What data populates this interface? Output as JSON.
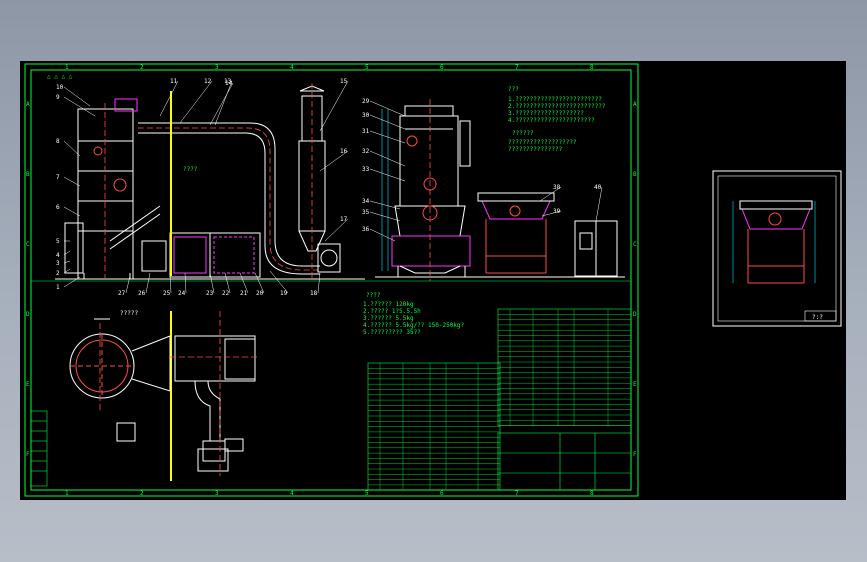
{
  "colors": {
    "viewport_bg": "#000000",
    "frame": "#00ff3c",
    "equipment": "#ffffff",
    "ducting": "#ff4a4a",
    "centerline": "#ffff00",
    "dimension": "#00e5ff",
    "highlight": "#ff33ff",
    "notes": "#00ff3c"
  },
  "zone_numbers_top": [
    "1",
    "2",
    "3",
    "4",
    "5",
    "6",
    "7",
    "8"
  ],
  "zone_numbers_bottom": [
    "1",
    "2",
    "3",
    "4",
    "5",
    "6",
    "7",
    "8"
  ],
  "zone_letters_side": [
    "A",
    "B",
    "C",
    "D",
    "E",
    "F"
  ],
  "revision_marks": [
    "△",
    "△",
    "△",
    "△"
  ],
  "callouts_left": [
    "10",
    "9",
    "8",
    "7",
    "6",
    "5",
    "4",
    "3",
    "2",
    "1"
  ],
  "callouts_top": [
    "11",
    "12",
    "13",
    "14",
    "15",
    "16",
    "17"
  ],
  "callouts_bottom": [
    "27",
    "26",
    "25",
    "24",
    "23",
    "22",
    "21",
    "20",
    "19",
    "18"
  ],
  "callouts_middle": [
    "29",
    "30",
    "31",
    "32",
    "33",
    "34",
    "35",
    "36"
  ],
  "callouts_right": [
    "38",
    "39",
    "40"
  ],
  "notes_top": {
    "heading": "???",
    "lines": [
      "1.????????????????????????",
      "2.?????????????????????????",
      "3.???????????????????",
      "4.??????????????????????"
    ],
    "heading2": "??????",
    "lines2": [
      "???????????????????",
      "???????????????"
    ]
  },
  "notes_middle": {
    "heading": "????",
    "lines": [
      "1.?????? 120kg",
      "2.????? 1?5.5.5h",
      "3.?????? 5.5kg",
      "4.?????? 5.5kg/?? 150-250kg?",
      "5.????????? 35??"
    ]
  },
  "centerline_label": "????",
  "plan_label": "?????",
  "detail_sheet_title": "?:?",
  "bom_rows": 24,
  "title_block_labels": [
    "?",
    "?",
    "?",
    "?",
    "?",
    "?"
  ]
}
